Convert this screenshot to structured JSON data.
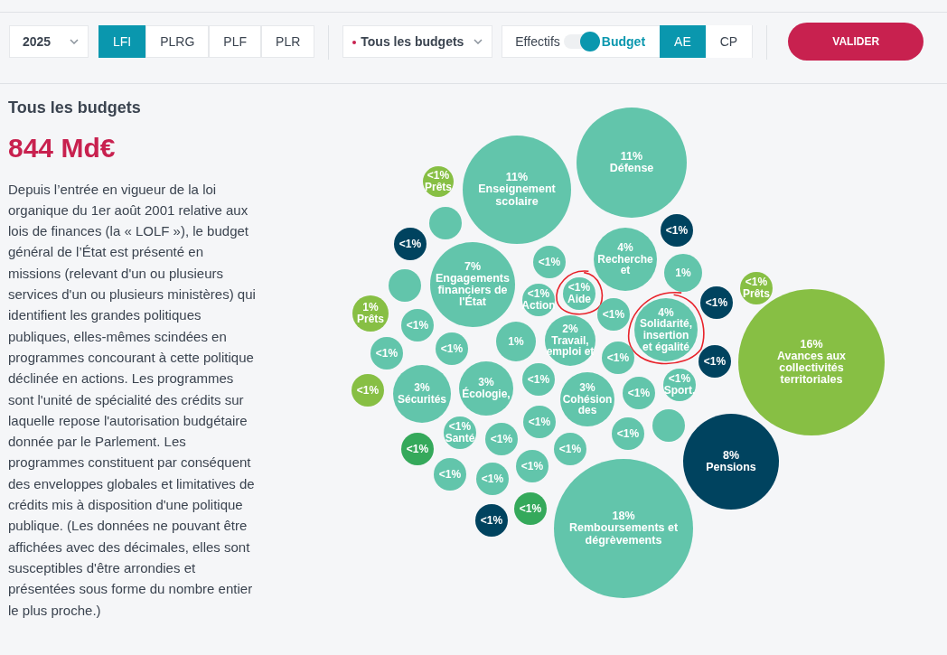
{
  "toolbar": {
    "year": {
      "value": "2025"
    },
    "stages": [
      {
        "label": "LFI",
        "selected": true
      },
      {
        "label": "PLRG",
        "selected": false
      },
      {
        "label": "PLF",
        "selected": false
      },
      {
        "label": "PLR",
        "selected": false
      }
    ],
    "budget_select": {
      "value": "Tous les budgets"
    },
    "view_toggle": {
      "left_label": "Effectifs",
      "right_label": "Budget",
      "on": true
    },
    "credit_types": [
      {
        "label": "AE",
        "selected": true
      },
      {
        "label": "CP",
        "selected": false
      }
    ],
    "submit": "VALIDER"
  },
  "summary": {
    "title": "Tous les budgets",
    "total": "844 Md€",
    "description": "Depuis l’entrée en vigueur de la loi organique du 1er août 2001 relative aux lois de finances (la « LOLF »), le budget général de l’État est présenté en missions (relevant d'un ou plusieurs services d'un ou plusieurs ministères) qui identifient les grandes politiques publiques, elles-mêmes scindées en programmes concourant à cette politique déclinée en actions. Les programmes sont l'unité de spécialité des crédits sur laquelle repose l'autorisation budgétaire donnée par le Parlement. Les programmes constituent par conséquent des enveloppes globales et limitatives de crédits mis à disposition d'une politique publique. (Les données ne pouvant être affichées avec des décimales, elles sont susceptibles d'être arrondies et présentées sous forme du nombre entier le plus proche.)"
  },
  "bubbles": [
    {
      "pct": "<1%",
      "label": "Prêts",
      "color": "#87bf44",
      "circled": false
    },
    {
      "pct": "11%",
      "label": "Enseignement\nscolaire",
      "color": "#62c5ab",
      "circled": false
    },
    {
      "pct": "11%",
      "label": "Défense",
      "color": "#62c5ab",
      "circled": false
    },
    {
      "color": "#62c5ab",
      "circled": false
    },
    {
      "pct": "<1%",
      "color": "#00435f",
      "circled": false
    },
    {
      "pct": "<1%",
      "color": "#00435f",
      "circled": false
    },
    {
      "pct": "7%",
      "label": "Engagements\nfinanciers de\nl'État",
      "color": "#62c5ab",
      "circled": false
    },
    {
      "pct": "<1%",
      "color": "#62c5ab",
      "circled": false
    },
    {
      "pct": "4%",
      "label": "Recherche\net",
      "color": "#62c5ab",
      "circled": false
    },
    {
      "pct": "1%",
      "color": "#62c5ab",
      "circled": false
    },
    {
      "color": "#62c5ab",
      "circled": false
    },
    {
      "pct": "<1%",
      "label": "Aide",
      "color": "#62c5ab",
      "circled": true
    },
    {
      "pct": "<1%",
      "label": "Action",
      "color": "#62c5ab",
      "circled": false
    },
    {
      "pct": "<1%",
      "color": "#00435f",
      "circled": false
    },
    {
      "pct": "<1%",
      "label": "Prêts",
      "color": "#87bf44",
      "circled": false
    },
    {
      "pct": "1%",
      "label": "Prêts",
      "color": "#87bf44",
      "circled": false
    },
    {
      "pct": "<1%",
      "color": "#62c5ab",
      "circled": false
    },
    {
      "pct": "<1%",
      "color": "#62c5ab",
      "circled": false
    },
    {
      "pct": "2%",
      "label": "Travail,\nemploi et",
      "color": "#62c5ab",
      "circled": false
    },
    {
      "pct": "4%",
      "label": "Solidarité,\ninsertion\net égalité",
      "color": "#62c5ab",
      "circled": true
    },
    {
      "pct": "<1%",
      "color": "#62c5ab",
      "circled": false
    },
    {
      "pct": "<1%",
      "color": "#62c5ab",
      "circled": false
    },
    {
      "pct": "1%",
      "color": "#62c5ab",
      "circled": false
    },
    {
      "pct": "<1%",
      "color": "#62c5ab",
      "circled": false
    },
    {
      "pct": "<1%",
      "color": "#00435f",
      "circled": false
    },
    {
      "pct": "16%",
      "label": "Avances aux\ncollectivités\nterritoriales",
      "color": "#87bf44",
      "circled": false
    },
    {
      "pct": "<1%",
      "color": "#87bf44",
      "circled": false
    },
    {
      "pct": "3%",
      "label": "Sécurités",
      "color": "#62c5ab",
      "circled": false
    },
    {
      "pct": "3%",
      "label": "Écologie,",
      "color": "#62c5ab",
      "circled": false
    },
    {
      "pct": "<1%",
      "color": "#62c5ab",
      "circled": false
    },
    {
      "pct": "3%",
      "label": "Cohésion\ndes",
      "color": "#62c5ab",
      "circled": false
    },
    {
      "pct": "<1%",
      "color": "#62c5ab",
      "circled": false
    },
    {
      "pct": "<1%",
      "label": "Sport.",
      "color": "#62c5ab",
      "circled": false
    },
    {
      "pct": "<1%",
      "color": "#62c5ab",
      "circled": false
    },
    {
      "pct": "<1%",
      "label": "Santé",
      "color": "#62c5ab",
      "circled": false
    },
    {
      "pct": "<1%",
      "color": "#62c5ab",
      "circled": false
    },
    {
      "pct": "<1%",
      "color": "#35a95b",
      "circled": false
    },
    {
      "pct": "<1%",
      "color": "#62c5ab",
      "circled": false
    },
    {
      "color": "#62c5ab",
      "circled": false
    },
    {
      "pct": "<1%",
      "color": "#62c5ab",
      "circled": false
    },
    {
      "pct": "8%",
      "label": "Pensions",
      "color": "#00435f",
      "circled": false
    },
    {
      "pct": "<1%",
      "color": "#62c5ab",
      "circled": false
    },
    {
      "pct": "<1%",
      "color": "#62c5ab",
      "circled": false
    },
    {
      "pct": "<1%",
      "color": "#62c5ab",
      "circled": false
    },
    {
      "pct": "<1%",
      "color": "#35a95b",
      "circled": false
    },
    {
      "pct": "<1%",
      "color": "#00435f",
      "circled": false
    },
    {
      "pct": "18%",
      "label": "Remboursements et\ndégrèvements",
      "color": "#62c5ab",
      "circled": false
    }
  ]
}
